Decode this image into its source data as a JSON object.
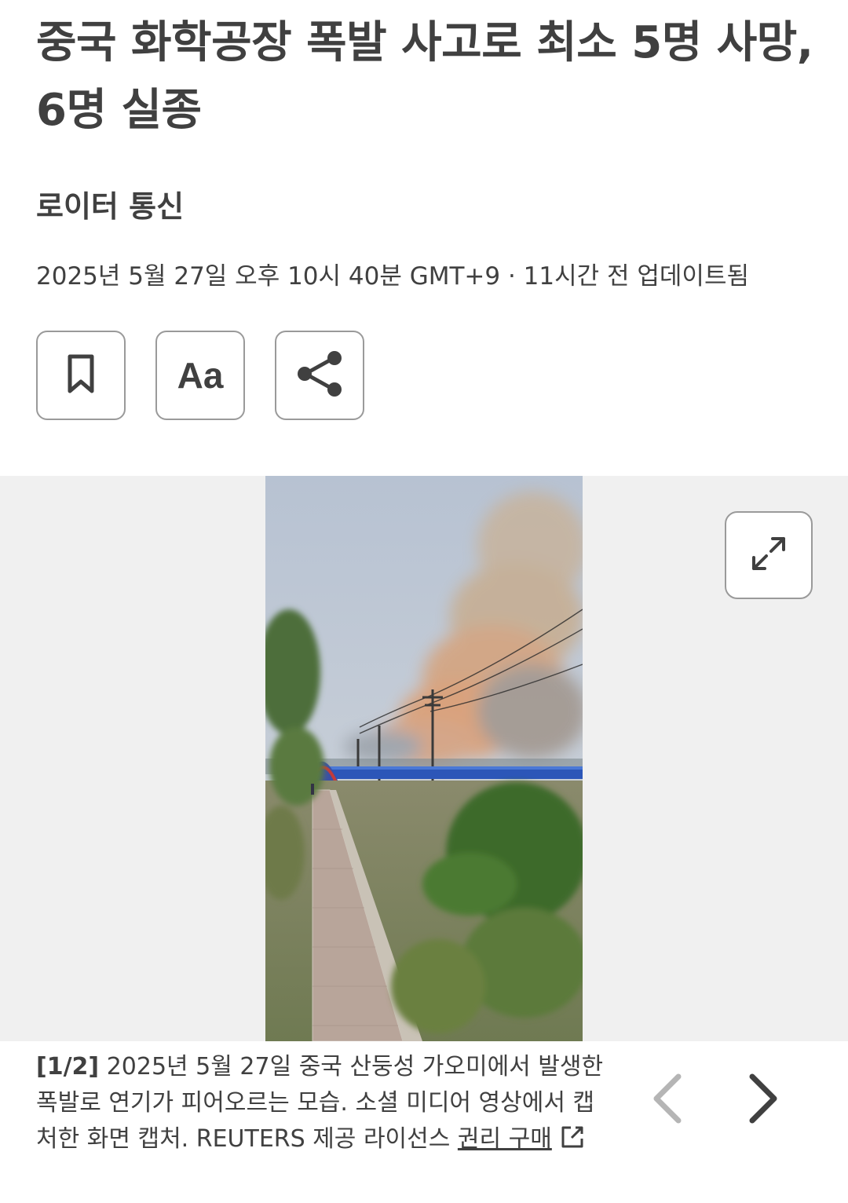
{
  "article": {
    "headline": "중국 화학공장 폭발 사고로 최소 5명 사망, 6명 실종",
    "byline": "로이터 통신",
    "dateline": "2025년 5월 27일 오후 10시 40분 GMT+9 · 11시간 전 업데이트됨"
  },
  "actions": {
    "bookmark_icon": "bookmark-icon",
    "text_size_label": "Aa",
    "share_icon": "share-icon"
  },
  "gallery": {
    "expand_icon": "expand-icon",
    "image_alt": "2025년 5월 27일 중국 산둥성 가오미에서 발생한 폭발로 연기가 피어오르는 모습",
    "counter": "[1/2]",
    "caption": "2025년 5월 27일 중국 산둥성 가오미에서 발생한 폭발로 연기가 피어오르는 모습. 소셜 미디어 영상에서 캡처한 화면 캡처. REUTERS 제공 라이선스",
    "rights_link": "권리 구매",
    "prev_icon": "chevron-left-icon",
    "next_icon": "chevron-right-icon",
    "prev_enabled": false,
    "next_enabled": true
  },
  "colors": {
    "text": "#404040",
    "border": "#9a9a9a",
    "gallery_bg": "#f0f0f0",
    "disabled_arrow": "#b5b5b5"
  }
}
